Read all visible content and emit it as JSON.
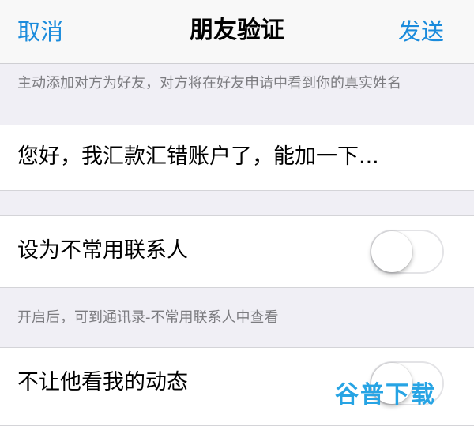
{
  "nav": {
    "cancel": "取消",
    "title": "朋友验证",
    "send": "发送"
  },
  "verify": {
    "hint": "主动添加对方为好友，对方将在好友申请中看到你的真实姓名",
    "message": "您好，我汇款汇错账户了，能加一下..."
  },
  "settings": {
    "uncommon_contact": {
      "label": "设为不常用联系人",
      "enabled": false
    },
    "uncommon_hint": "开启后，可到通讯录-不常用联系人中查看",
    "hide_moments": {
      "label": "不让他看我的动态",
      "enabled": false
    }
  },
  "watermark": "谷普下载",
  "colors": {
    "accent": "#1a8bdc",
    "background": "#f0eff5",
    "watermark": "#27a4e4"
  }
}
